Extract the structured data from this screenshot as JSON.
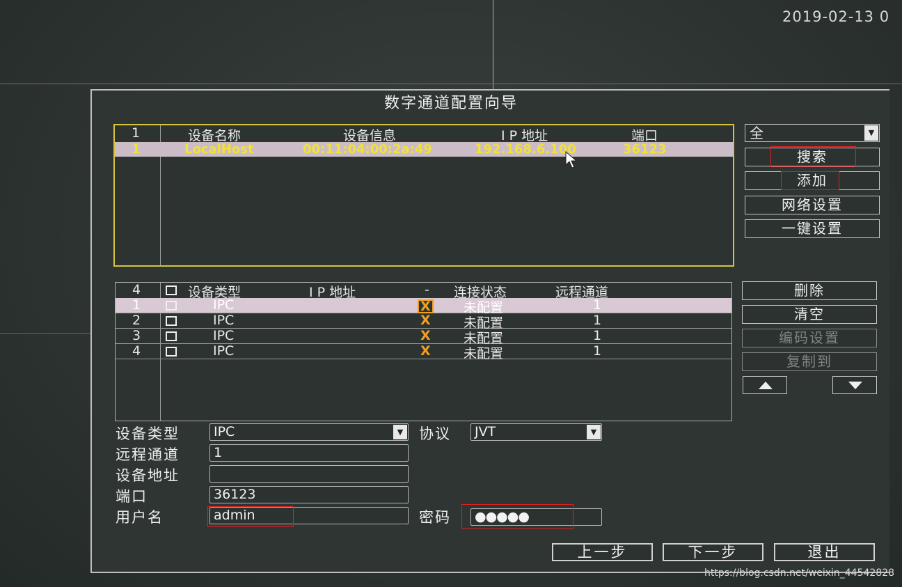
{
  "datetime": "2019-02-13 0",
  "dialog_title": "数字通道配置向导",
  "search_table": {
    "header": {
      "count": "1",
      "name": "设备名称",
      "info": "设备信息",
      "ip": "I P 地址",
      "port": "端口"
    },
    "rows": [
      {
        "index": "1",
        "name": "LocalHost",
        "info": "00:11:04:00:2a:49",
        "ip": "192.168.6.100",
        "port": "36123"
      }
    ]
  },
  "filter_select": {
    "value": "全"
  },
  "side_buttons_top": {
    "search": "搜索",
    "add": "添加",
    "network": "网络设置",
    "onekey": "一键设置"
  },
  "channel_table": {
    "header": {
      "count": "4",
      "type": "设备类型",
      "ip": "I P 地址",
      "dash": "-",
      "status": "连接状态",
      "remote": "远程通道"
    },
    "rows": [
      {
        "index": "1",
        "type": "IPC",
        "mark": "X",
        "status": "未配置",
        "remote": "1"
      },
      {
        "index": "2",
        "type": "IPC",
        "mark": "X",
        "status": "未配置",
        "remote": "1"
      },
      {
        "index": "3",
        "type": "IPC",
        "mark": "X",
        "status": "未配置",
        "remote": "1"
      },
      {
        "index": "4",
        "type": "IPC",
        "mark": "X",
        "status": "未配置",
        "remote": "1"
      }
    ]
  },
  "side_buttons_bottom": {
    "delete": "删除",
    "clear": "清空",
    "encode": "编码设置",
    "copy": "复制到"
  },
  "form": {
    "device_type_label": "设备类型",
    "device_type": "IPC",
    "protocol_label": "协议",
    "protocol": "JVT",
    "remote_channel_label": "远程通道",
    "remote_channel": "1",
    "address_label": "设备地址",
    "address": "",
    "port_label": "端口",
    "port": "36123",
    "username_label": "用户名",
    "username": "admin",
    "password_label": "密码",
    "password": "●●●●●"
  },
  "nav": {
    "prev": "上一步",
    "next": "下一步",
    "exit": "退出"
  },
  "watermark": "https://blog.csdn.net/weixin_44542828"
}
